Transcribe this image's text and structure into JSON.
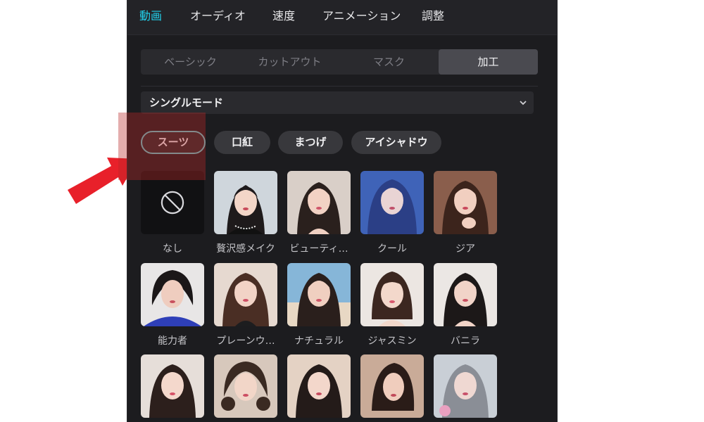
{
  "top_tabs": [
    {
      "label": "動画",
      "active": true
    },
    {
      "label": "オーディオ",
      "active": false
    },
    {
      "label": "速度",
      "active": false
    },
    {
      "label": "アニメーション",
      "active": false
    },
    {
      "label": "調整",
      "active": false
    }
  ],
  "sub_tabs": [
    {
      "label": "ベーシック",
      "active": false
    },
    {
      "label": "カットアウト",
      "active": false
    },
    {
      "label": "マスク",
      "active": false
    },
    {
      "label": "加工",
      "active": true
    }
  ],
  "mode_dropdown": {
    "value": "シングルモード",
    "icon": "chevron-down-icon"
  },
  "categories": [
    {
      "label": "スーツ",
      "active": true
    },
    {
      "label": "口紅",
      "active": false
    },
    {
      "label": "まつげ",
      "active": false
    },
    {
      "label": "アイシャドウ",
      "active": false
    }
  ],
  "presets_row1": [
    {
      "label": "なし",
      "icon": "no-effect-icon"
    },
    {
      "label": "贅沢感メイク"
    },
    {
      "label": "ビューティ…"
    },
    {
      "label": "クール"
    },
    {
      "label": "ジア"
    }
  ],
  "presets_row2": [
    {
      "label": "能力者"
    },
    {
      "label": "プレーンウ…"
    },
    {
      "label": "ナチュラル"
    },
    {
      "label": "ジャスミン"
    },
    {
      "label": "バニラ"
    }
  ],
  "colors": {
    "panel_bg": "#1c1c1f",
    "accent": "#22d3ee",
    "chip_active_border": "#63c7c9",
    "highlight": "#b72828",
    "arrow": "#e8202a"
  }
}
